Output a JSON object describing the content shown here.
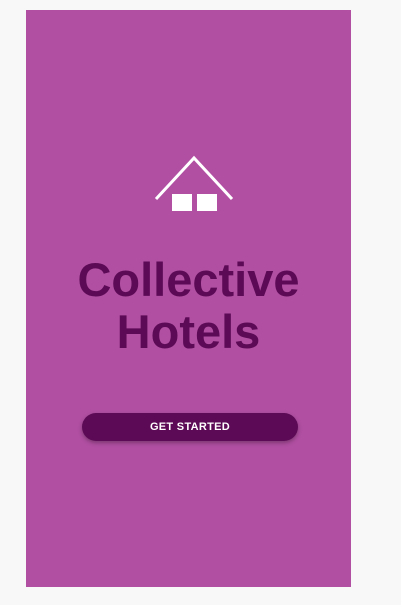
{
  "app": {
    "title_line1": "Collective",
    "title_line2": "Hotels"
  },
  "cta": {
    "label": "GET STARTED"
  },
  "icons": {
    "logo": "house-icon"
  },
  "colors": {
    "background": "#b14fa2",
    "title": "#5c0a55",
    "button": "#5c0a55",
    "button_text": "#ffffff",
    "logo": "#ffffff"
  }
}
